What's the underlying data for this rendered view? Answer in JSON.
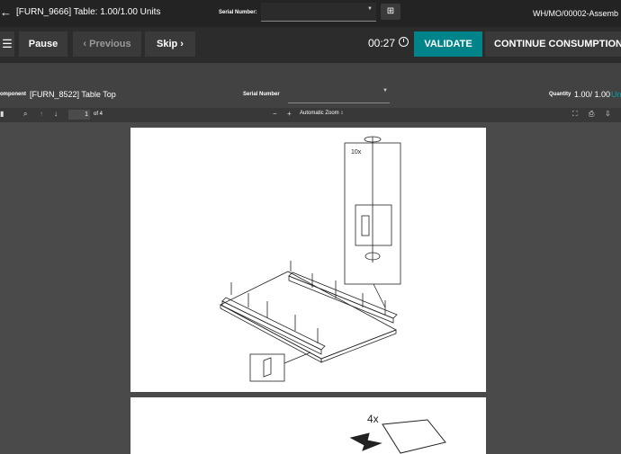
{
  "header": {
    "title": "[FURN_9666] Table: 1.00/1.00 Units",
    "serial_label": "Serial Number:",
    "mo_reference": "WH/MO/00002-Assemb"
  },
  "actions": {
    "pause": "Pause",
    "previous": "‹ Previous",
    "skip": "Skip ›",
    "timer": "00:27",
    "validate": "VALIDATE",
    "continue": "CONTINUE CONSUMPTION"
  },
  "component": {
    "label": "omponent",
    "name": "[FURN_8522] Table Top",
    "serial_label": "Serial Number",
    "quantity_label": "Quantity",
    "quantity_value": "1.00/ 1.00",
    "quantity_unit": "Un"
  },
  "pdf": {
    "current_page": "1",
    "page_count": "of 4",
    "zoom": "Automatic Zoom",
    "step_count_1": "10x",
    "step_count_2": "4x"
  },
  "colors": {
    "validate": "#00848a",
    "topbar": "#232323",
    "actionbar": "#2c2c2c"
  }
}
